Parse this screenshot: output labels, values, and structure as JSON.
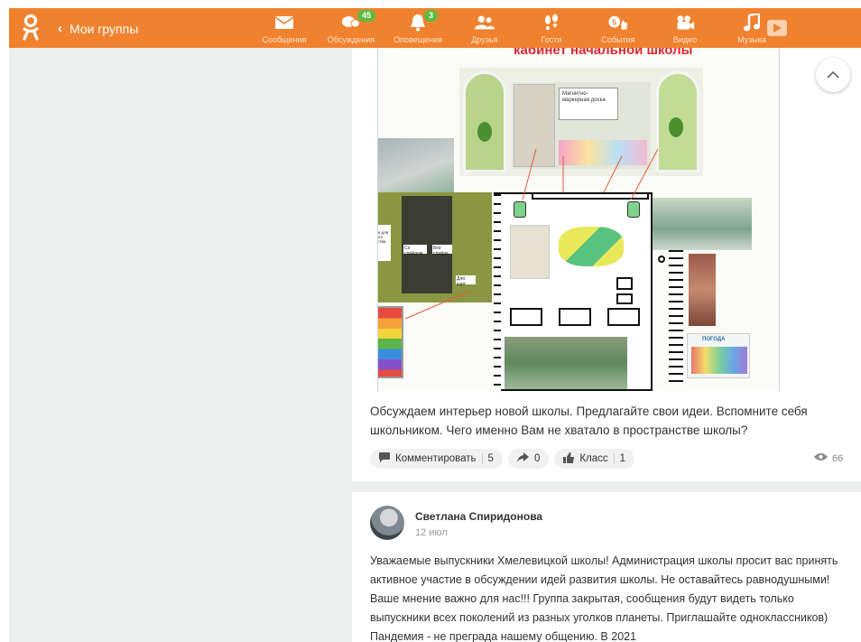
{
  "topbar": {
    "back_label": "Мои группы",
    "nav": [
      {
        "label": "Сообщения",
        "icon": "envelope-icon",
        "badge": ""
      },
      {
        "label": "Обсуждения",
        "icon": "chat-bubbles-icon",
        "badge": "45"
      },
      {
        "label": "Оповещения",
        "icon": "bell-icon",
        "badge": "3"
      },
      {
        "label": "Друзья",
        "icon": "friends-icon",
        "badge": ""
      },
      {
        "label": "Гости",
        "icon": "footprints-icon",
        "badge": ""
      },
      {
        "label": "События",
        "icon": "events-icon",
        "badge": ""
      },
      {
        "label": "Видео",
        "icon": "video-camera-icon",
        "badge": ""
      },
      {
        "label": "Музыка",
        "icon": "music-note-icon",
        "badge": ""
      }
    ],
    "colors": {
      "bar": "#f0822f",
      "badge": "#5dbb3f"
    }
  },
  "post1": {
    "image_title": "кабинет начальной школы",
    "image_labels": {
      "board": "Магнитно-маркерная доска",
      "shelf1": "Полки рабочие для для всего творчества",
      "shelf2": "Со слайдом",
      "shelf3": "Без слайда",
      "shelf4": "Для карт",
      "weather": "ПОГОДА"
    },
    "text": "Обсуждаем интерьер новой школы. Предлагайте свои идеи. Вспомните себя школьником. Чего именно Вам не хватало в пространстве школы?",
    "comment_label": "Комментировать",
    "comment_count": "5",
    "share_count": "0",
    "like_label": "Класс",
    "like_count": "1",
    "views": "66"
  },
  "post2": {
    "author": "Светлана Спиридонова",
    "date": "12 июл",
    "text": "Уважаемые выпускники Хмелевицкой школы! Администрация школы просит вас принять активное участие в обсуждении идей развития школы. Не оставайтесь равнодушными! Ваше мнение важно для нас!!! Группа закрытая, сообщения будут видеть только выпускники всех поколений из разных уголков планеты. Приглашайте одноклассников) Пандемия  - не преграда нашему общению. В 2021"
  }
}
